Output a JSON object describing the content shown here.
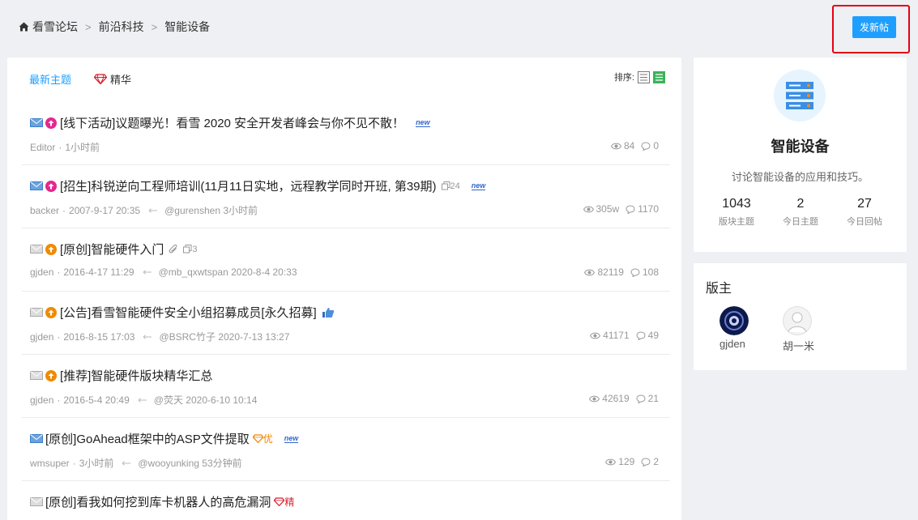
{
  "breadcrumb": {
    "home": "看雪论坛",
    "section": "前沿科技",
    "forum": "智能设备",
    "separator": ">"
  },
  "post_button": "发新帖",
  "tabs": {
    "latest": "最新主题",
    "essence": "精华"
  },
  "sort_label": "排序:",
  "threads": [
    {
      "prefix": "[线下活动]",
      "title": "议题曝光！看雪 2020 安全开发者峰会与你不见不散！",
      "arrow_color": "#e5278f",
      "envelope": "blue",
      "new": "new",
      "author": "Editor",
      "date": "1小时前",
      "last_reply": "",
      "views": "84",
      "replies": "0"
    },
    {
      "prefix": "[招生]",
      "title": "科锐逆向工程师培训(11月11日实地，远程教学同时开班, 第39期)",
      "arrow_color": "#e5278f",
      "envelope": "blue",
      "pages": "24",
      "new": "new",
      "author": "backer",
      "date": "2007-9-17 20:35",
      "last_reply": "@gurenshen 3小时前",
      "views": "305w",
      "replies": "1170"
    },
    {
      "prefix": "[原创]",
      "title": "智能硬件入门",
      "arrow_color": "#f08a00",
      "envelope": "gray",
      "attach": true,
      "pages": "3",
      "author": "gjden",
      "date": "2016-4-17 11:29",
      "last_reply": "@mb_qxwtspan 2020-8-4 20:33",
      "views": "82119",
      "replies": "108"
    },
    {
      "prefix": "[公告]",
      "title": "看雪智能硬件安全小组招募成员[永久招募]",
      "arrow_color": "#f08a00",
      "envelope": "gray",
      "thumb": true,
      "author": "gjden",
      "date": "2016-8-15 17:03",
      "last_reply": "@BSRC竹子 2020-7-13 13:27",
      "views": "41171",
      "replies": "49"
    },
    {
      "prefix": "[推荐]",
      "title": "智能硬件版块精华汇总",
      "arrow_color": "#f08a00",
      "envelope": "gray",
      "author": "gjden",
      "date": "2016-5-4 20:49",
      "last_reply": "@荧天 2020-6-10 10:14",
      "views": "42619",
      "replies": "21"
    },
    {
      "prefix": "[原创]",
      "title": "GoAhead框架中的ASP文件提取",
      "envelope": "blue",
      "tag": "优",
      "tag_color": "#f08300",
      "new": "new",
      "author": "wmsuper",
      "date": "3小时前",
      "last_reply": "@wooyunking 53分钟前",
      "views": "129",
      "replies": "2"
    },
    {
      "prefix": "[原创]",
      "title": "看我如何挖到库卡机器人的高危漏洞",
      "envelope": "gray",
      "tag": "精",
      "tag_color": "#d81e2c"
    }
  ],
  "forum_card": {
    "name": "智能设备",
    "description": "讨论智能设备的应用和技巧。",
    "stats": [
      {
        "value": "1043",
        "label": "版块主题"
      },
      {
        "value": "2",
        "label": "今日主题"
      },
      {
        "value": "27",
        "label": "今日回帖"
      }
    ]
  },
  "moderators": {
    "title": "版主",
    "list": [
      {
        "name": "gjden"
      },
      {
        "name": "胡一米"
      }
    ]
  },
  "colors": {
    "accent": "#1e9fff",
    "highlight_border": "#e60012"
  }
}
